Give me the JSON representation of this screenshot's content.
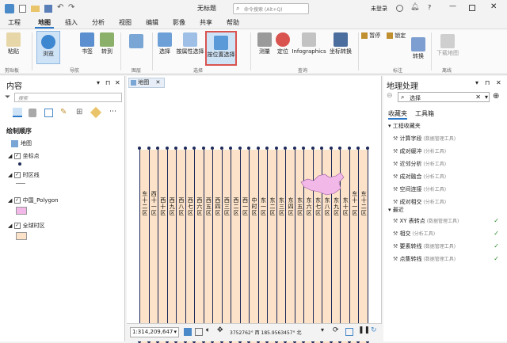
{
  "titlebar": {
    "title": "无标题",
    "search_placeholder": "命令搜索 (Alt+Q)",
    "user": "未登录",
    "help": "?"
  },
  "tabs": [
    "工程",
    "地图",
    "插入",
    "分析",
    "视图",
    "编辑",
    "影像",
    "共享",
    "帮助"
  ],
  "ribbon": {
    "clipboard": {
      "paste": "粘贴",
      "group": "剪贴板"
    },
    "navigate": {
      "explore": "浏览",
      "bookmarks": "书签",
      "goto": "转到",
      "group": "导航"
    },
    "layer": {
      "group": "图层"
    },
    "selection": {
      "select": "选择",
      "by_attr": "按属性选择",
      "by_location": "按位置选择",
      "group": "选择"
    },
    "inquiry": {
      "measure": "测量",
      "locate": "定位",
      "infographics": "Infographics",
      "convert": "坐标转换",
      "group": "查询"
    },
    "labeling": {
      "pause": "暂停",
      "lock": "锁定",
      "convert": "转换",
      "group": "标注"
    },
    "offline": {
      "download": "下载地图",
      "group": "离线"
    }
  },
  "contents": {
    "title": "内容",
    "search_placeholder": "搜索",
    "draw_order": "绘制顺序",
    "map": "地图",
    "layers": [
      {
        "name": "坐标点",
        "color": "#1e2a5a"
      },
      {
        "name": "时区线",
        "color": "#888888"
      },
      {
        "name": "中国_Polygon",
        "color": "#f2b8e8"
      },
      {
        "name": "全球时区",
        "color": "#fbe2c8"
      }
    ]
  },
  "map": {
    "tab": "地图",
    "scale": "1:314,209,647",
    "coords": "3752762° 西  185.9563457° 北",
    "zone_color": "#fbe2c8",
    "line_color": "#1e2a5a"
  },
  "zones": [
    "东十二区",
    "西十一区",
    "西十区",
    "西九区",
    "西八区",
    "西七区",
    "西六区",
    "西五区",
    "西四区",
    "西三区",
    "西二区",
    "西一区",
    "中时区",
    "东一区",
    "东二区",
    "东三区",
    "东四区",
    "东五区",
    "东六区",
    "东七区",
    "东八区",
    "东九区",
    "东十区",
    "东十一区",
    "东十二区"
  ],
  "geoprocessing": {
    "title": "地理处理",
    "search_value": "选择",
    "tab_favorites": "收藏夹",
    "tab_toolboxes": "工具箱",
    "project_favorites": "工程收藏夹",
    "favorites": [
      {
        "name": "计算字段",
        "box": "(数据管理工具)"
      },
      {
        "name": "成对缓冲",
        "box": "(分析工具)"
      },
      {
        "name": "近邻分析",
        "box": "(分析工具)"
      },
      {
        "name": "成对融合",
        "box": "(分析工具)"
      },
      {
        "name": "空间连接",
        "box": "(分析工具)"
      },
      {
        "name": "成对相交",
        "box": "(分析工具)"
      }
    ],
    "recent": "最近",
    "recents": [
      {
        "name": "XY 表转点",
        "box": "(数据管理工具)"
      },
      {
        "name": "相交",
        "box": "(分析工具)"
      },
      {
        "name": "要素转线",
        "box": "(数据管理工具)"
      },
      {
        "name": "点集转线",
        "box": "(数据管理工具)"
      }
    ]
  }
}
